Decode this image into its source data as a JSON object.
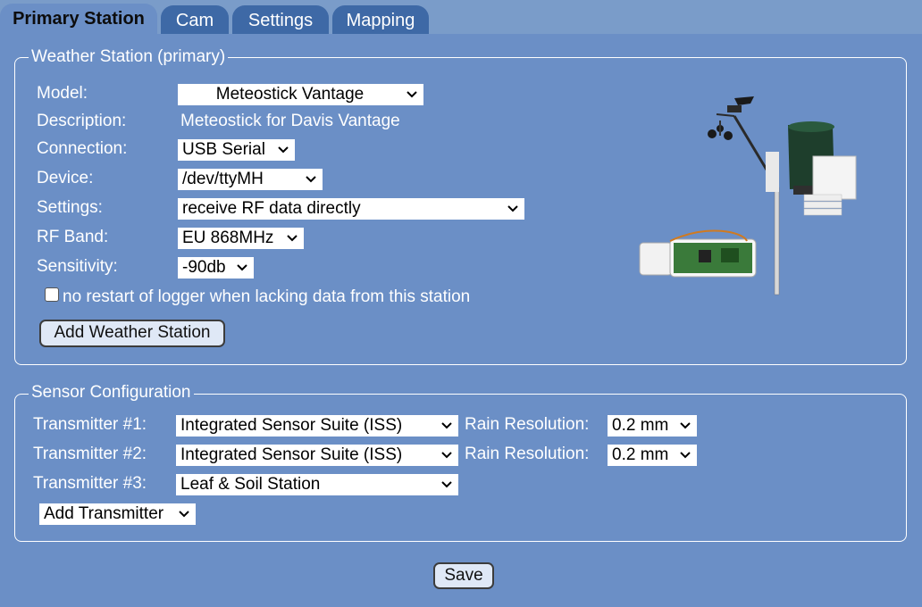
{
  "tabs": [
    {
      "label": "Primary Station",
      "active": true
    },
    {
      "label": "Cam",
      "active": false
    },
    {
      "label": "Settings",
      "active": false
    },
    {
      "label": "Mapping",
      "active": false
    }
  ],
  "weather_station": {
    "legend": "Weather Station (primary)",
    "model_label": "Model:",
    "model_value": "Meteostick Vantage",
    "description_label": "Description:",
    "description_value": "Meteostick for Davis Vantage",
    "connection_label": "Connection:",
    "connection_value": "USB Serial",
    "device_label": "Device:",
    "device_value": "/dev/ttyMH",
    "settings_label": "Settings:",
    "settings_value": "receive RF data directly",
    "rfband_label": "RF Band:",
    "rfband_value": "EU 868MHz",
    "sensitivity_label": "Sensitivity:",
    "sensitivity_value": "-90db",
    "no_restart_label": "no restart of logger when lacking data from this station",
    "no_restart_checked": false,
    "add_button": "Add Weather Station"
  },
  "sensor_config": {
    "legend": "Sensor Configuration",
    "transmitters": [
      {
        "label": "Transmitter #1:",
        "value": "Integrated Sensor Suite (ISS)",
        "rain_label": "Rain Resolution:",
        "rain_value": "0.2 mm"
      },
      {
        "label": "Transmitter #2:",
        "value": "Integrated Sensor Suite (ISS)",
        "rain_label": "Rain Resolution:",
        "rain_value": "0.2 mm"
      },
      {
        "label": "Transmitter #3:",
        "value": "Leaf & Soil Station"
      }
    ],
    "add_transmitter": "Add Transmitter"
  },
  "save_button": "Save",
  "colors": {
    "background": "#6b8fc6",
    "tab_inactive": "#3e69a6",
    "tab_bar": "#7a9cc9"
  },
  "icons": {
    "select_arrow": "chevron-down-icon",
    "device_image": "weather-station-image"
  }
}
